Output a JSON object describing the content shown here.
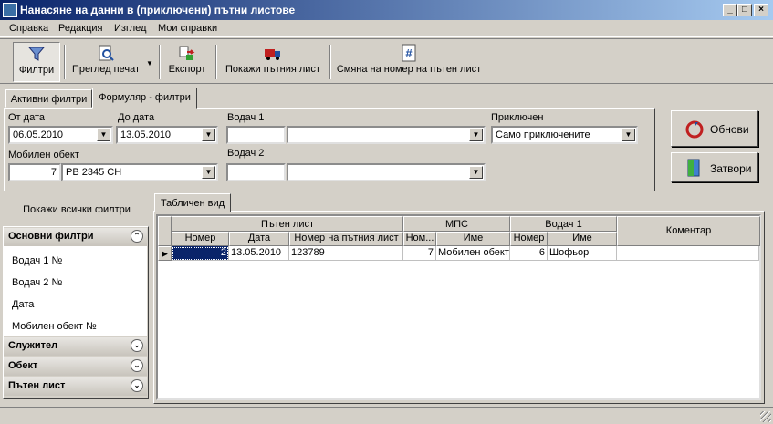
{
  "window": {
    "title": "Нанасяне на данни в (приключени) пътни листове",
    "min": "_",
    "max": "□",
    "close": "×"
  },
  "menu": [
    "Справка",
    "Редакция",
    "Изглед",
    "Мои справки"
  ],
  "toolbar": {
    "filters": "Филтри",
    "preview": "Преглед печат",
    "export": "Експорт",
    "show_sheet": "Покажи пътния лист",
    "change_number": "Смяна на номер на пътен лист"
  },
  "tabs": {
    "active_filters": "Активни филтри",
    "form_filters": "Формуляр - филтри"
  },
  "form": {
    "from_date_label": "От дата",
    "from_date": "06.05.2010",
    "to_date_label": "До дата",
    "to_date": "13.05.2010",
    "driver1_label": "Водач 1",
    "driver1_code": "",
    "driver1_name": "",
    "driver2_label": "Водач 2",
    "driver2_code": "",
    "driver2_name": "",
    "closed_label": "Приключен",
    "closed_value": "Само приключените",
    "vehicle_label": "Мобилен обект",
    "vehicle_id": "7",
    "vehicle_name": "PB 2345 CH"
  },
  "buttons": {
    "refresh": "Обнови",
    "close": "Затвори"
  },
  "sidebar": {
    "show_all": "Покажи всички филтри",
    "main_group": "Основни филтри",
    "items": [
      "Водач 1 №",
      "Водач 2 №",
      "Дата",
      "Мобилен обект №"
    ],
    "groups": [
      "Служител",
      "Обект",
      "Пътен лист"
    ]
  },
  "view_tab": "Табличен вид",
  "table": {
    "groups": {
      "sheet": "Пътен лист",
      "mps": "МПС",
      "driver1": "Водач 1",
      "comment": "Коментар"
    },
    "columns": [
      "Номер",
      "Дата",
      "Номер на пътния лист",
      "Ном...",
      "Име",
      "Номер",
      "Име"
    ],
    "rows": [
      [
        "2",
        "13.05.2010",
        "123789",
        "7",
        "Мобилен обект",
        "6",
        "Шофьор",
        ""
      ]
    ]
  },
  "colors": {
    "title_start": "#0a246a",
    "title_end": "#a6caf0",
    "selected_cell": "#0a246a"
  }
}
